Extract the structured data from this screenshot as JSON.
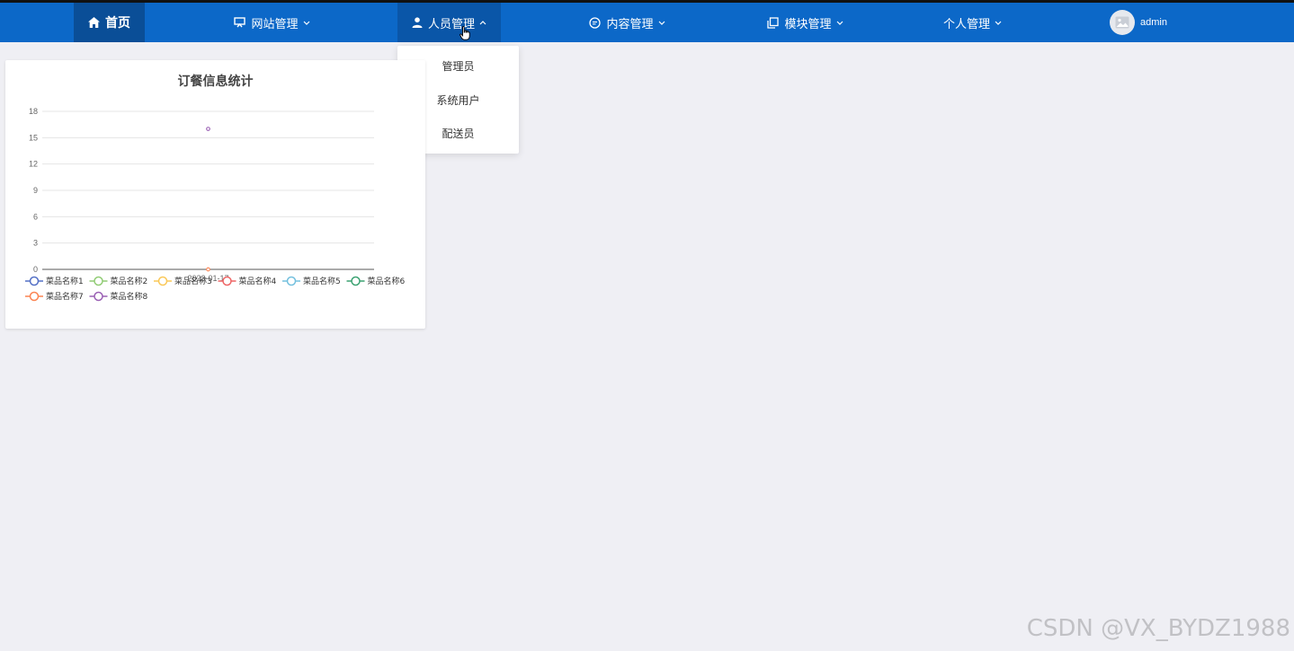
{
  "nav": {
    "home": "首页",
    "items": [
      {
        "label": "网站管理"
      },
      {
        "label": "人员管理"
      },
      {
        "label": "内容管理"
      },
      {
        "label": "模块管理"
      },
      {
        "label": "个人管理"
      }
    ],
    "user": "admin"
  },
  "dropdown": {
    "items": [
      "管理员",
      "系统用户",
      "配送员"
    ]
  },
  "card": {
    "title": "订餐信息统计"
  },
  "chart_data": {
    "type": "line",
    "title": "订餐信息统计",
    "x": [
      "2023-01-17"
    ],
    "ylim": [
      0,
      18
    ],
    "yticks": [
      0,
      3,
      6,
      9,
      12,
      15,
      18
    ],
    "grid": true,
    "legend_position": "bottom",
    "series": [
      {
        "name": "菜品名称1",
        "color": "#5470c6",
        "values": [
          null
        ]
      },
      {
        "name": "菜品名称2",
        "color": "#91cc75",
        "values": [
          null
        ]
      },
      {
        "name": "菜品名称3",
        "color": "#fac858",
        "values": [
          null
        ]
      },
      {
        "name": "菜品名称4",
        "color": "#ee6666",
        "values": [
          null
        ]
      },
      {
        "name": "菜品名称5",
        "color": "#73c0de",
        "values": [
          null
        ]
      },
      {
        "name": "菜品名称6",
        "color": "#3ba272",
        "values": [
          null
        ]
      },
      {
        "name": "菜品名称7",
        "color": "#fc8452",
        "values": [
          0
        ]
      },
      {
        "name": "菜品名称8",
        "color": "#9a60b4",
        "values": [
          16
        ]
      }
    ]
  },
  "watermark": "CSDN @VX_BYDZ1988"
}
